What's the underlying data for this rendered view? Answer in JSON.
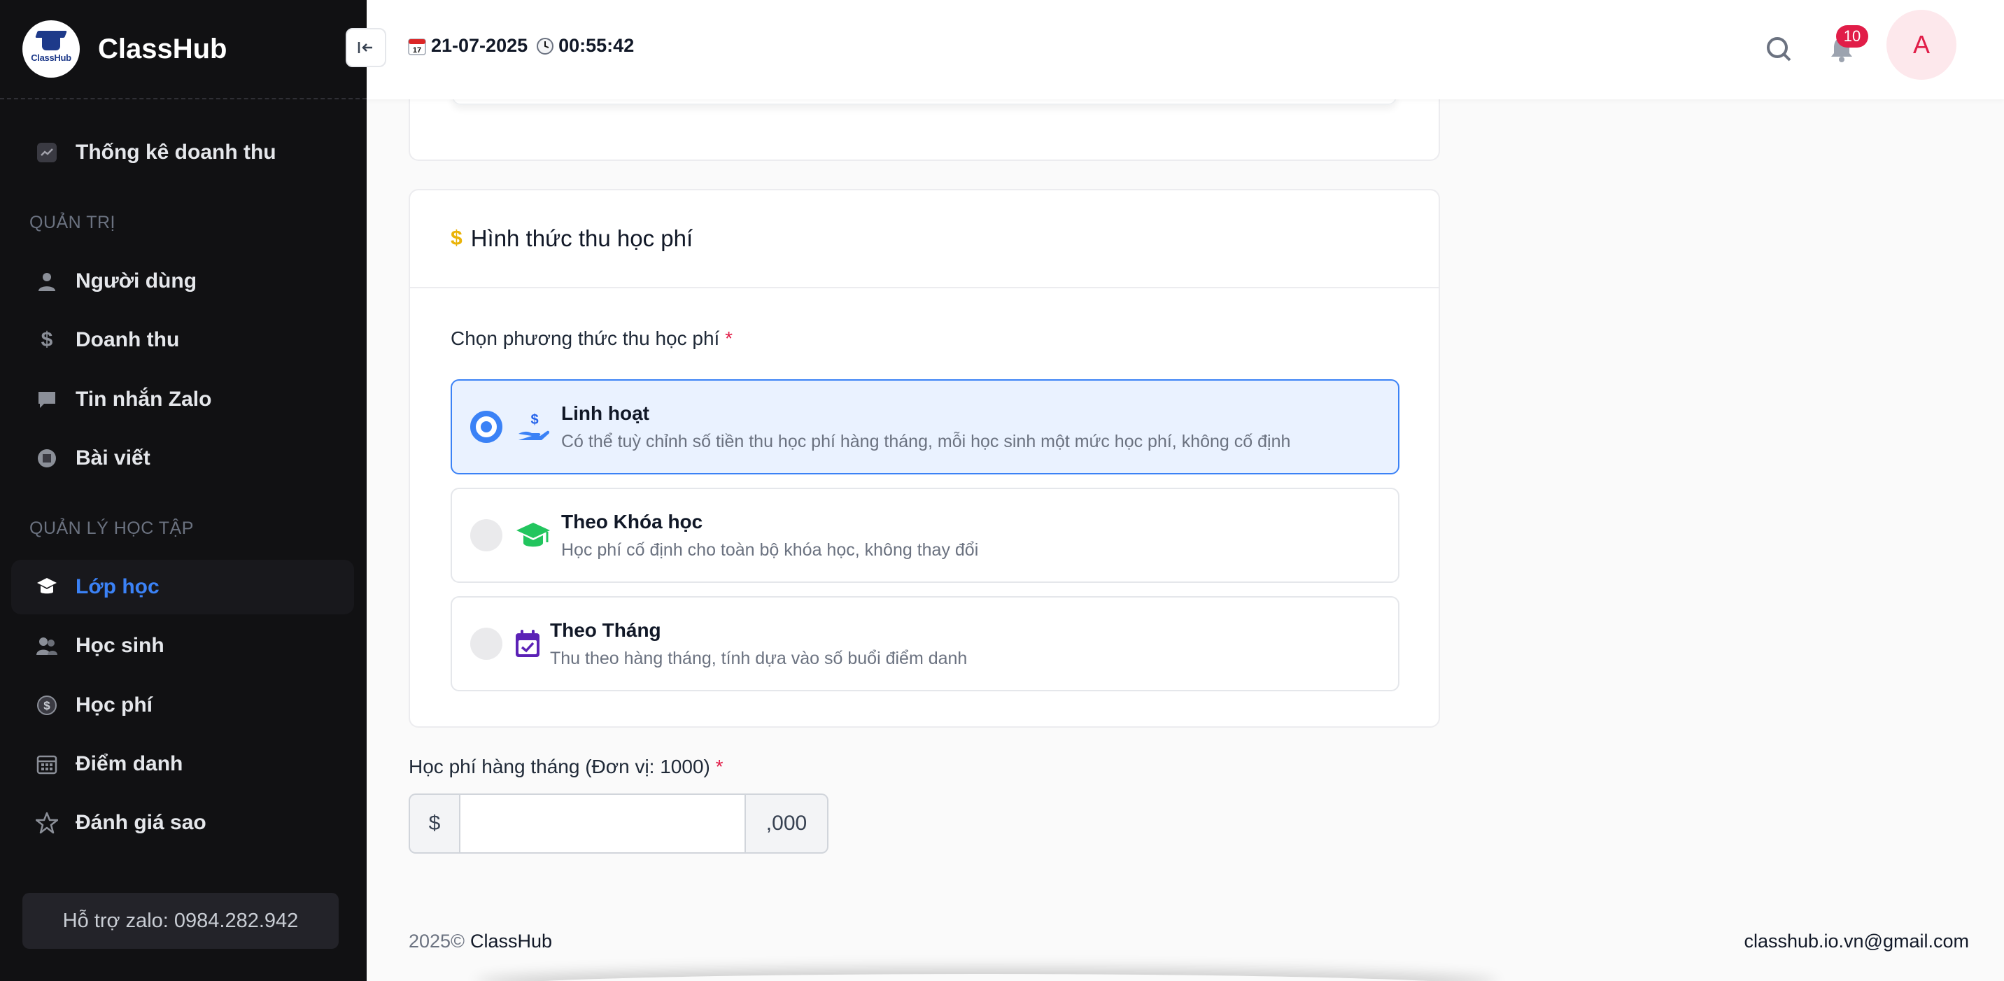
{
  "sidebar": {
    "brand": "ClassHub",
    "logo_text": "ClassHub",
    "items": [
      {
        "label": "Thống kê doanh thu",
        "icon": "chart-icon"
      },
      {
        "label": "Người dùng",
        "icon": "user-icon"
      },
      {
        "label": "Doanh thu",
        "icon": "dollar-icon"
      },
      {
        "label": "Tin nhắn Zalo",
        "icon": "message-icon"
      },
      {
        "label": "Bài viết",
        "icon": "article-icon"
      },
      {
        "label": "Lớp học",
        "icon": "class-icon",
        "active": true
      },
      {
        "label": "Học sinh",
        "icon": "students-icon"
      },
      {
        "label": "Học phí",
        "icon": "fee-coin-icon"
      },
      {
        "label": "Điểm danh",
        "icon": "calendar-icon"
      },
      {
        "label": "Đánh giá sao",
        "icon": "star-icon"
      }
    ],
    "sections": {
      "admin": "QUẢN TRỊ",
      "learning": "QUẢN LÝ HỌC TẬP"
    },
    "support": "Hỗ trợ zalo: 0984.282.942"
  },
  "topbar": {
    "date": "21-07-2025",
    "time": "00:55:42",
    "notifications": "10",
    "avatar_initial": "A"
  },
  "fee_card": {
    "title": "Hình thức thu học phí",
    "field_label": "Chọn phương thức thu học phí",
    "required_mark": "*",
    "options": [
      {
        "title": "Linh hoạt",
        "desc": "Có thể tuỳ chỉnh số tiền thu học phí hàng tháng, mỗi học sinh một mức học phí, không cố định",
        "selected": true
      },
      {
        "title": "Theo Khóa học",
        "desc": "Học phí cố định cho toàn bộ khóa học, không thay đổi",
        "selected": false
      },
      {
        "title": "Theo Tháng",
        "desc": "Thu theo hàng tháng, tính dựa vào số buổi điểm danh",
        "selected": false
      }
    ]
  },
  "monthly_fee": {
    "label": "Học phí hàng tháng (Đơn vị: 1000)",
    "required_mark": "*",
    "prefix": "$",
    "suffix": ",000",
    "value": ""
  },
  "footer": {
    "year": "2025©",
    "brand": "ClassHub",
    "email": "classhub.io.vn@gmail.com"
  },
  "colors": {
    "sidebar_bg": "#111113",
    "accent": "#3b82f6",
    "danger": "#e11d48",
    "dollar": "#eab308",
    "cap_green": "#22c55e",
    "calendar_purple": "#5b21b6"
  }
}
